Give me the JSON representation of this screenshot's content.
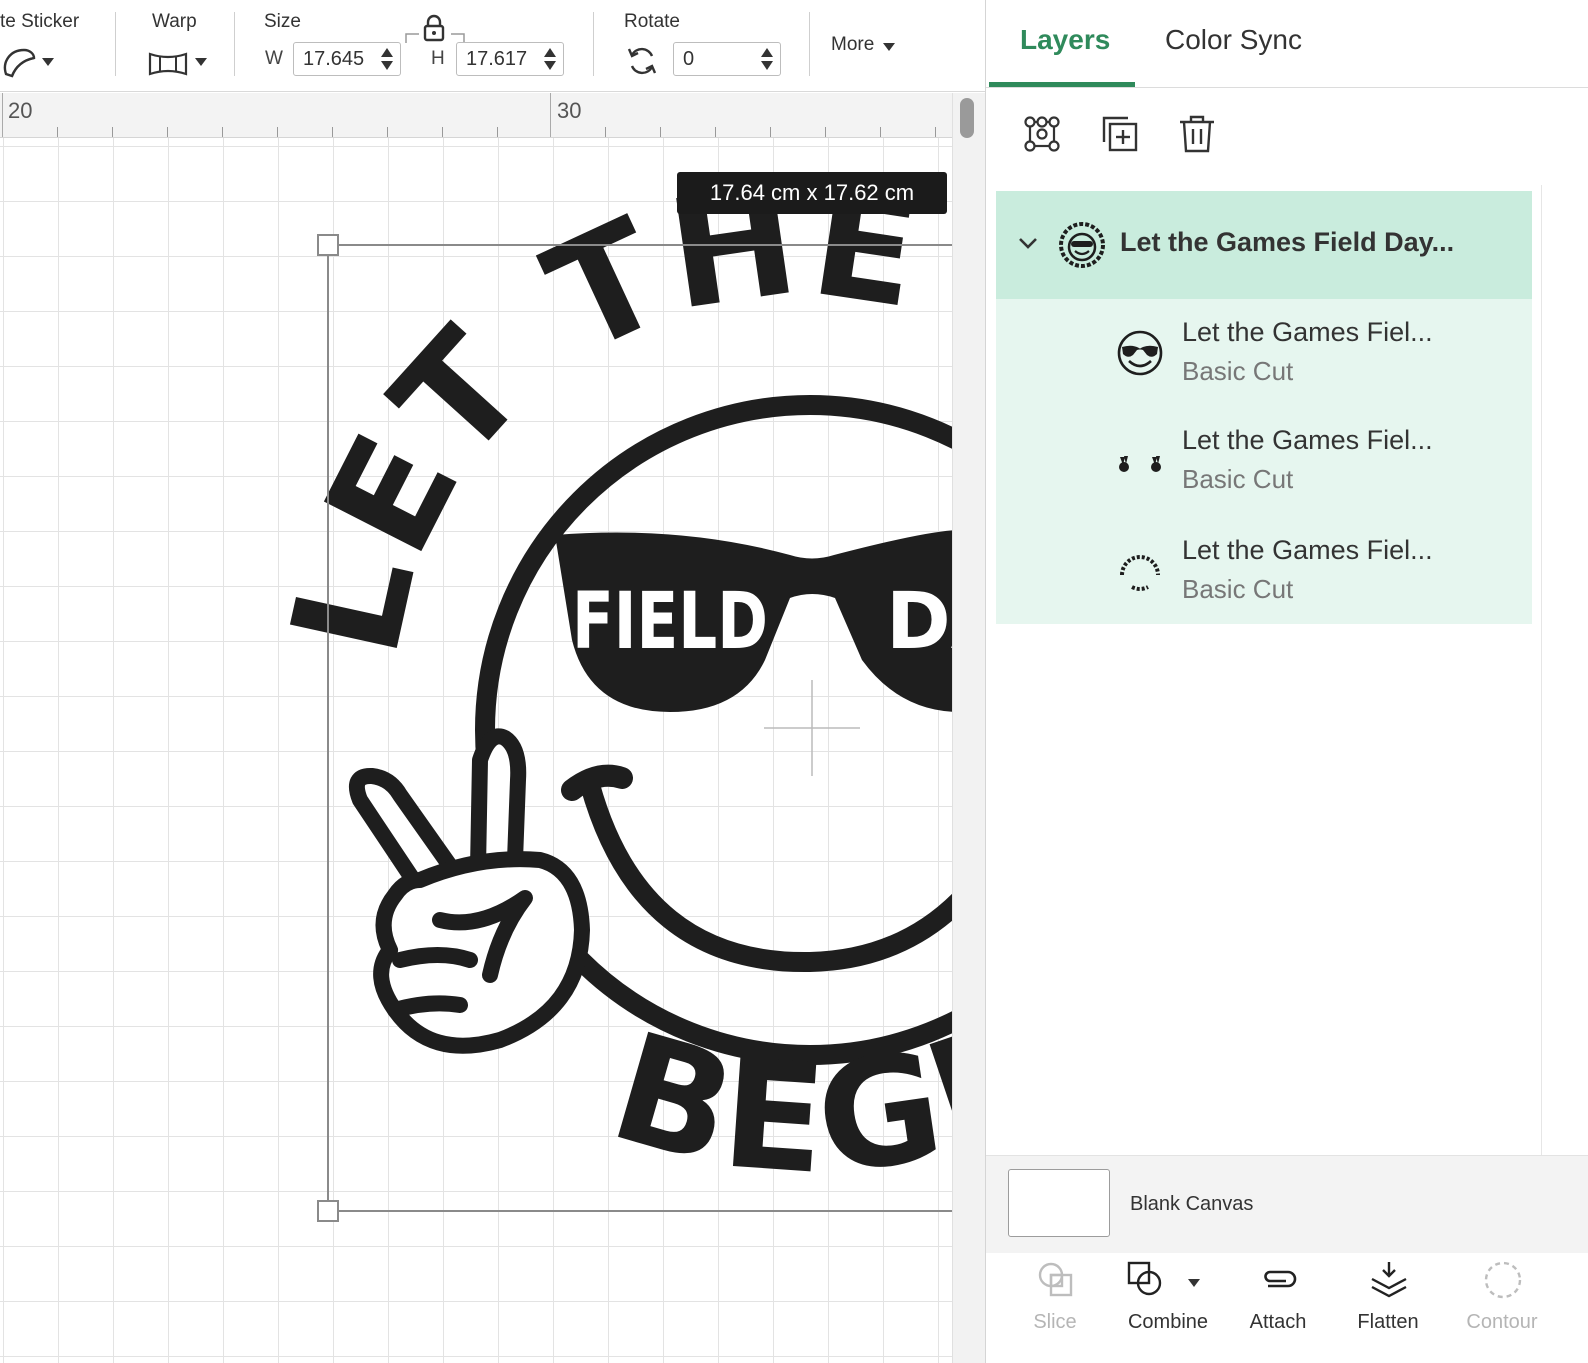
{
  "toolbar": {
    "sticker_label": "te Sticker",
    "warp_label": "Warp",
    "size_label": "Size",
    "w_label": "W",
    "w_value": "17.645",
    "h_label": "H",
    "h_value": "17.617",
    "rotate_label": "Rotate",
    "rotate_value": "0",
    "more_label": "More"
  },
  "ruler": {
    "marks": [
      "20",
      "30"
    ]
  },
  "canvas": {
    "size_tooltip": "17.64  cm x 17.62  cm",
    "design": {
      "arc_top_text": "LET THE G",
      "glasses_left_text": "FIELD",
      "glasses_right_text": "DA",
      "arc_bottom_text": "BEGI"
    }
  },
  "panel": {
    "tabs": [
      {
        "label": "Layers",
        "active": true
      },
      {
        "label": "Color Sync",
        "active": false
      }
    ],
    "group": {
      "name": "Let the Games Field Day..."
    },
    "layers": [
      {
        "name": "Let the Games Fiel...",
        "type": "Basic Cut",
        "thumb": "smiley-sunglasses-icon"
      },
      {
        "name": "Let the Games Fiel...",
        "type": "Basic Cut",
        "thumb": "peace-hands-icon"
      },
      {
        "name": "Let the Games Fiel...",
        "type": "Basic Cut",
        "thumb": "arc-text-icon"
      }
    ],
    "blank_canvas_label": "Blank Canvas",
    "bottom_actions": [
      {
        "label": "Slice",
        "icon": "slice-icon",
        "enabled": false
      },
      {
        "label": "Combine",
        "icon": "combine-icon",
        "enabled": true
      },
      {
        "label": "Attach",
        "icon": "attach-icon",
        "enabled": true
      },
      {
        "label": "Flatten",
        "icon": "flatten-icon",
        "enabled": true
      },
      {
        "label": "Contour",
        "icon": "contour-icon",
        "enabled": false
      }
    ]
  },
  "colors": {
    "accent": "#2f8a5b",
    "group_bg": "#c9ecdd",
    "children_bg": "#e6f6ef",
    "design_ink": "#1e1e1e"
  }
}
